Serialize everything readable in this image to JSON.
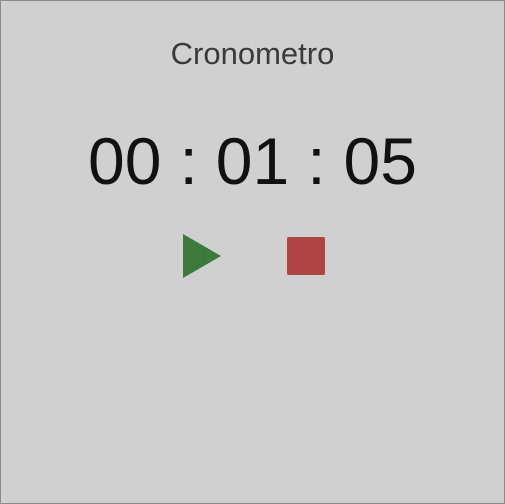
{
  "app": {
    "title": "Cronometro"
  },
  "timer": {
    "hours": "00",
    "minutes": "01",
    "seconds": "05",
    "separator": ":"
  },
  "controls": {
    "play_icon": "play-icon",
    "stop_icon": "stop-icon"
  },
  "colors": {
    "background": "#d0d0d0",
    "play": "#3c7a3c",
    "stop": "#b04343",
    "text": "#111111"
  }
}
